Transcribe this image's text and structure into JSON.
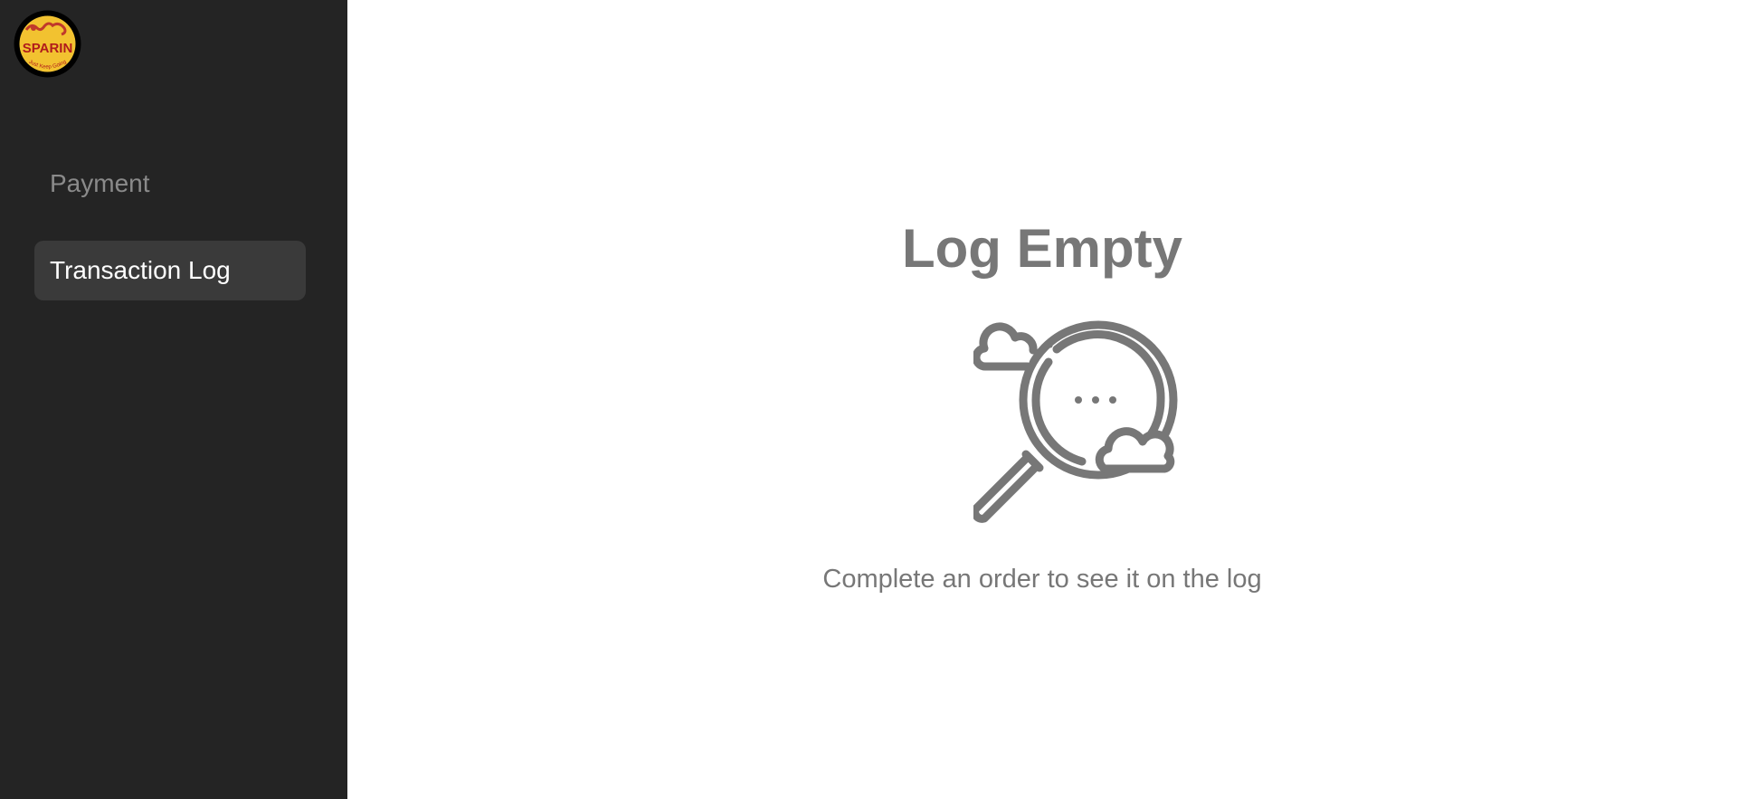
{
  "brand": {
    "logo_icon": "sparin-logo-icon",
    "logo_text": "SPARIN",
    "logo_tagline": "Just Keep Going",
    "colors": {
      "primary": "#f2c230",
      "secondary": "#c0392b",
      "ring": "#000000"
    }
  },
  "sidebar": {
    "items": [
      {
        "label": "Payment",
        "active": false
      },
      {
        "label": "Transaction Log",
        "active": true
      }
    ]
  },
  "main": {
    "title": "Log Empty",
    "icon": "magnifier-clouds-icon",
    "subtitle": "Complete an order to see it on the log"
  },
  "colors": {
    "sidebar_bg": "#242424",
    "active_item_bg": "#3a3a3a",
    "muted_text": "#777777"
  }
}
